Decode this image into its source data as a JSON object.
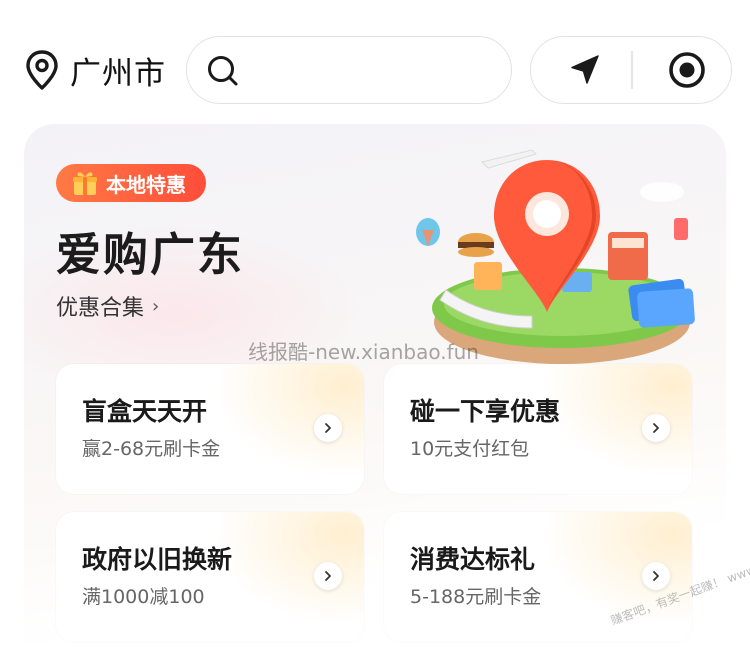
{
  "location": {
    "city": "广州市",
    "icon": "map-pin-icon"
  },
  "search": {
    "placeholder": "",
    "icon": "search-icon"
  },
  "actions": {
    "navigate_icon": "navigation-arrow-icon",
    "record_icon": "target-icon"
  },
  "promo": {
    "badge_label": "本地特惠",
    "badge_icon": "gift-icon",
    "title": "爱购广东",
    "subtitle": "优惠合集",
    "subtitle_chevron": "›",
    "illustration": "location-pin-city-illustration",
    "accent": "#ff5a3c",
    "watermark": "线报酷-new.xianbao.fun"
  },
  "cards": [
    {
      "title": "盲盒天天开",
      "subtitle": "赢2-68元刷卡金"
    },
    {
      "title": "碰一下享优惠",
      "subtitle": "10元支付红包"
    },
    {
      "title": "政府以旧换新",
      "subtitle": "满1000减100"
    },
    {
      "title": "消费达标礼",
      "subtitle": "5-188元刷卡金"
    }
  ],
  "corner_watermark": "赚客吧，有奖一起赚！ www.zuanke8.com"
}
